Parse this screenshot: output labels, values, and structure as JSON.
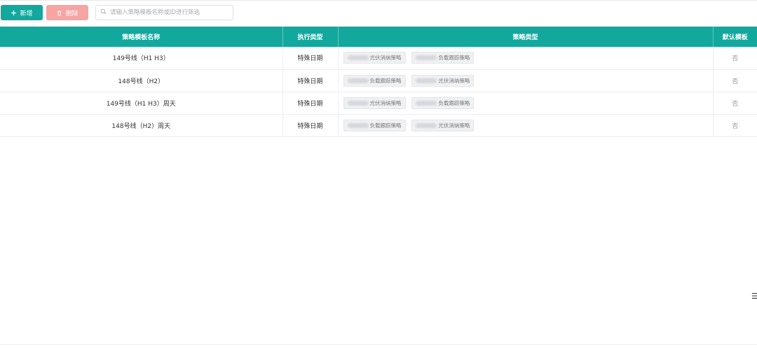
{
  "toolbar": {
    "add_label": "新增",
    "delete_label": "删除",
    "search_placeholder": "请输入策略模板名称或ID进行筛选"
  },
  "table": {
    "columns": [
      "策略模板名称",
      "执行类型",
      "策略类型",
      "默认模板"
    ],
    "rows": [
      {
        "name": "149号线（H1 H3）",
        "exec_type": "特殊日期",
        "tags": [
          "光伏消纳策略",
          "负载跟踪策略"
        ],
        "default": "否"
      },
      {
        "name": "148号线（H2）",
        "exec_type": "特殊日期",
        "tags": [
          "负载跟踪策略",
          "光伏消纳策略"
        ],
        "default": "否"
      },
      {
        "name": "149号线（H1 H3）周天",
        "exec_type": "特殊日期",
        "tags": [
          "光伏消纳策略",
          "负载跟踪策略"
        ],
        "default": "否"
      },
      {
        "name": "148号线（H2）周天",
        "exec_type": "特殊日期",
        "tags": [
          "负载跟踪策略",
          "光伏消纳策略"
        ],
        "default": "否"
      }
    ]
  },
  "colors": {
    "primary": "#13a89e",
    "danger_disabled": "#f6a4a4",
    "header_text": "#ffffff"
  },
  "icons": {
    "add": "plus-icon",
    "delete": "trash-icon",
    "search": "search-icon",
    "side": "list-icon"
  }
}
